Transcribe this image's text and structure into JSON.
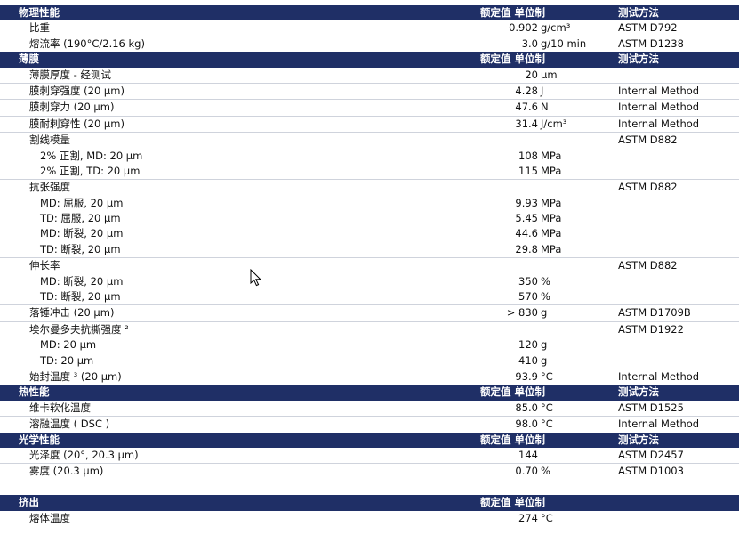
{
  "sections": [
    {
      "title": "物理性能",
      "value_header": "额定值 单位制",
      "method_header": "测试方法",
      "rows": [
        {
          "name": "比重",
          "value": "0.902",
          "unit": "g/cm³",
          "method": "ASTM D792"
        },
        {
          "name": "熔流率 (190°C/2.16 kg)",
          "value": "3.0",
          "unit": "g/10 min",
          "method": "ASTM D1238"
        }
      ]
    },
    {
      "title": "薄膜",
      "value_header": "额定值 单位制",
      "method_header": "测试方法",
      "rows": [
        {
          "name": "薄膜厚度 - 经测试",
          "value": "20",
          "unit": "µm",
          "method": ""
        },
        {
          "name": "膜刺穿强度 (20 µm)",
          "value": "4.28",
          "unit": "J",
          "method": "Internal Method",
          "sep": true
        },
        {
          "name": "膜刺穿力 (20 µm)",
          "value": "47.6",
          "unit": "N",
          "method": "Internal Method",
          "sep": true
        },
        {
          "name": "膜耐刺穿性 (20 µm)",
          "value": "31.4",
          "unit": "J/cm³",
          "method": "Internal Method",
          "sep": true
        },
        {
          "name": "割线模量",
          "value": "",
          "unit": "",
          "method": "ASTM D882",
          "sep": true
        },
        {
          "name": "2% 正割, MD: 20 µm",
          "value": "108",
          "unit": "MPa",
          "method": "",
          "sub": true
        },
        {
          "name": "2% 正割, TD: 20 µm",
          "value": "115",
          "unit": "MPa",
          "method": "",
          "sub": true
        },
        {
          "name": "抗张强度",
          "value": "",
          "unit": "",
          "method": "ASTM D882",
          "sep": true
        },
        {
          "name": "MD: 屈服, 20 µm",
          "value": "9.93",
          "unit": "MPa",
          "method": "",
          "sub": true
        },
        {
          "name": "TD: 屈服, 20 µm",
          "value": "5.45",
          "unit": "MPa",
          "method": "",
          "sub": true
        },
        {
          "name": "MD: 断裂, 20 µm",
          "value": "44.6",
          "unit": "MPa",
          "method": "",
          "sub": true
        },
        {
          "name": "TD: 断裂, 20 µm",
          "value": "29.8",
          "unit": "MPa",
          "method": "",
          "sub": true
        },
        {
          "name": "伸长率",
          "value": "",
          "unit": "",
          "method": "ASTM D882",
          "sep": true
        },
        {
          "name": "MD: 断裂, 20 µm",
          "value": "350",
          "unit": "%",
          "method": "",
          "sub": true
        },
        {
          "name": "TD: 断裂, 20 µm",
          "value": "570",
          "unit": "%",
          "method": "",
          "sub": true
        },
        {
          "name": "落锤冲击 (20 µm)",
          "value": "> 830",
          "unit": "g",
          "method": "ASTM D1709B",
          "sep": true
        },
        {
          "name": "埃尔曼多夫抗撕强度 ²",
          "value": "",
          "unit": "",
          "method": "ASTM D1922",
          "sep": true
        },
        {
          "name": "MD: 20 µm",
          "value": "120",
          "unit": "g",
          "method": "",
          "sub": true
        },
        {
          "name": "TD: 20 µm",
          "value": "410",
          "unit": "g",
          "method": "",
          "sub": true
        },
        {
          "name": "始封温度 ³ (20 µm)",
          "value": "93.9",
          "unit": "°C",
          "method": "Internal Method",
          "sep": true
        }
      ]
    },
    {
      "title": "热性能",
      "value_header": "额定值 单位制",
      "method_header": "测试方法",
      "rows": [
        {
          "name": "维卡软化温度",
          "value": "85.0",
          "unit": "°C",
          "method": "ASTM D1525"
        },
        {
          "name": "溶融温度 ( DSC )",
          "value": "98.0",
          "unit": "°C",
          "method": "Internal Method",
          "sep": true
        }
      ]
    },
    {
      "title": "光学性能",
      "value_header": "额定值 单位制",
      "method_header": "测试方法",
      "rows": [
        {
          "name": "光泽度 (20°, 20.3 µm)",
          "value": "144",
          "unit": "",
          "method": "ASTM D2457"
        },
        {
          "name": "雾度 (20.3 µm)",
          "value": "0.70",
          "unit": "%",
          "method": "ASTM D1003",
          "sep": true
        }
      ],
      "gap_after": true
    },
    {
      "title": "挤出",
      "value_header": "额定值 单位制",
      "method_header": "",
      "rows": [
        {
          "name": "熔体温度",
          "value": "274",
          "unit": "°C",
          "method": ""
        }
      ]
    }
  ],
  "colors": {
    "header_bg": "#1f2f66",
    "header_text": "#ffffff",
    "separator": "#cfd3dc"
  },
  "cursor": {
    "icon": "mouse-pointer-icon"
  }
}
